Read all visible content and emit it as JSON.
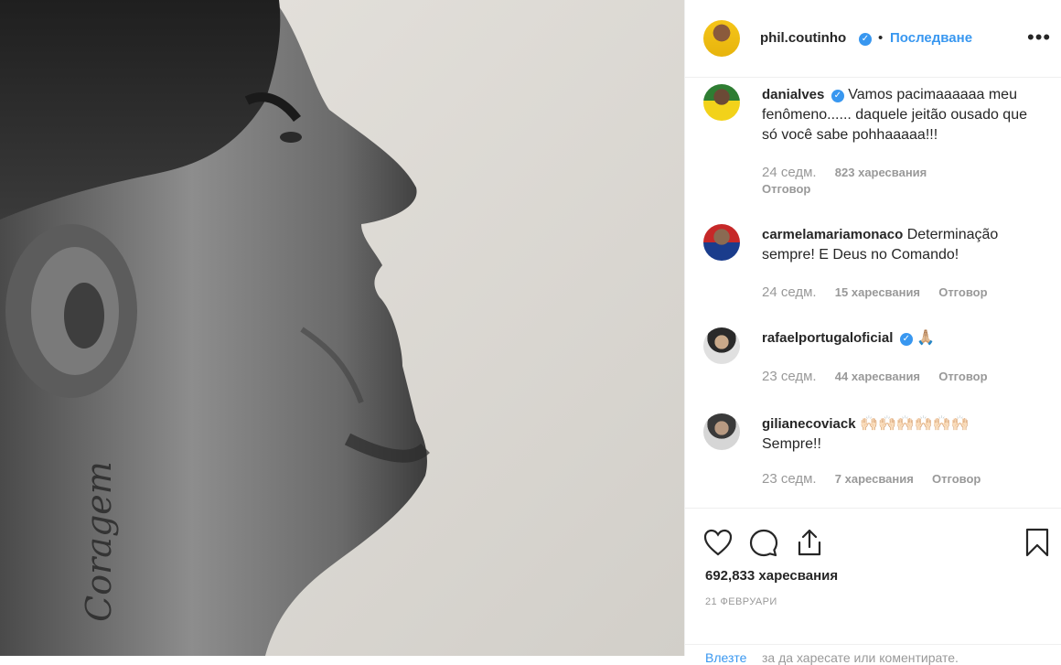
{
  "post": {
    "author": "phil.coutinho",
    "follow_label": "Последване",
    "separator": "•",
    "tattoo_text": "Coragem"
  },
  "comments": [
    {
      "user": "danialves",
      "verified": true,
      "text": "Vamos pacimaaaaaa meu fenômeno...... daquele jeitão ousado que só você sabe pohhaaaaa!!!",
      "time": "24 седм.",
      "likes": "823 харесвания",
      "reply": "Отговор"
    },
    {
      "user": "carmelamariamonaco",
      "verified": false,
      "text": "Determinação sempre! E Deus no Comando!",
      "time": "24 седм.",
      "likes": "15 харесвания",
      "reply": "Отговор"
    },
    {
      "user": "rafaelportugaloficial",
      "verified": true,
      "text": "🙏🏼",
      "time": "23 седм.",
      "likes": "44 харесвания",
      "reply": "Отговор"
    },
    {
      "user": "gilianecoviack",
      "verified": false,
      "text": "🙌🏻🙌🏻🙌🏻🙌🏻🙌🏻🙌🏻 Sempre!!",
      "time": "23 седм.",
      "likes": "7 харесвания",
      "reply": "Отговор"
    }
  ],
  "footer": {
    "likes_count": "692,833 харесвания",
    "date": "21 ФЕВРУАРИ",
    "login_link": "Влезте",
    "login_rest": "за да харесате или коментирате."
  },
  "colors": {
    "link": "#3897f0",
    "verified": "#3897f0",
    "muted": "#999999"
  },
  "icons": [
    "heart-icon",
    "comment-icon",
    "share-icon",
    "bookmark-icon",
    "more-options-icon",
    "verified-icon"
  ]
}
